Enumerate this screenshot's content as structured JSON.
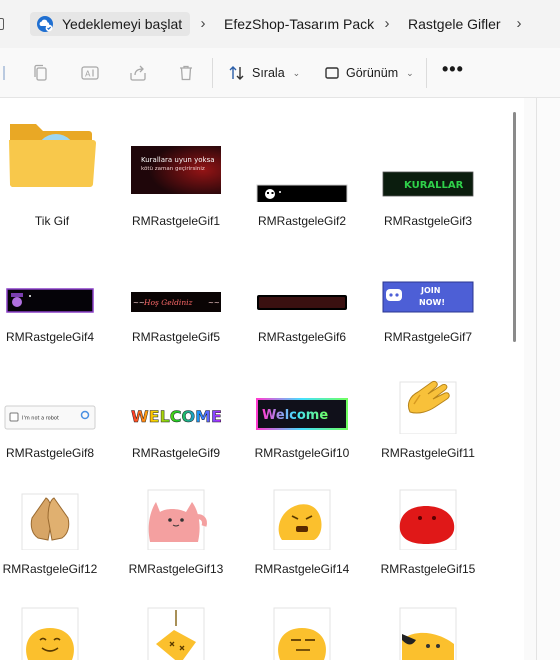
{
  "breadcrumb": {
    "home_label": "Yedeklemeyi başlat",
    "crumbs": [
      "EfezShop-Tasarım Pack",
      "Rastgele Gifler"
    ]
  },
  "toolbar": {
    "sort_label": "Sırala",
    "view_label": "Görünüm",
    "more_label": "•••"
  },
  "gif_captions": {
    "rules_line1": "Kurallara uyun yoksa",
    "rules_line2": "kötü zaman geçirirsiniz",
    "kurallar": "KURALLAR",
    "hos_geldiniz": "Hoş Geldiniz",
    "join_now_1": "JOIN",
    "join_now_2": "NOW!",
    "captcha": "I'm not a robot",
    "welcome_caps": "WELCOME",
    "welcome": "Welcome"
  },
  "files": [
    {
      "name": "Tik Gif",
      "type": "folder"
    },
    {
      "name": "RMRastgeleGif1"
    },
    {
      "name": "RMRastgeleGif2"
    },
    {
      "name": "RMRastgeleGif3"
    },
    {
      "name": "RMRastgeleGif4"
    },
    {
      "name": "RMRastgeleGif5"
    },
    {
      "name": "RMRastgeleGif6"
    },
    {
      "name": "RMRastgeleGif7"
    },
    {
      "name": "RMRastgeleGif8"
    },
    {
      "name": "RMRastgeleGif9"
    },
    {
      "name": "RMRastgeleGif10"
    },
    {
      "name": "RMRastgeleGif11"
    },
    {
      "name": "RMRastgeleGif12"
    },
    {
      "name": "RMRastgeleGif13"
    },
    {
      "name": "RMRastgeleGif14"
    },
    {
      "name": "RMRastgeleGif15"
    }
  ],
  "colors": {
    "folder": "#f5c244",
    "discord_blurple": "#5865f2",
    "blob_yellow": "#fbc02d",
    "blob_red": "#e02020",
    "blob_pink": "#f08c8c"
  }
}
